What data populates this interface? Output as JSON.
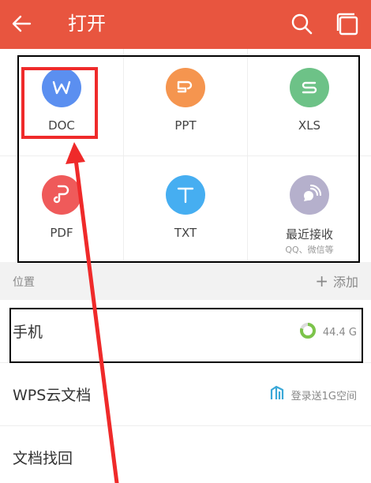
{
  "header": {
    "title": "打开",
    "back_icon": "back-arrow-icon",
    "search_icon": "search-icon",
    "windows_icon": "windows-icon",
    "background": "#e8553f"
  },
  "file_types": [
    {
      "label": "DOC",
      "glyph": "W",
      "color": "#5b8ff0",
      "icon": "doc-icon"
    },
    {
      "label": "PPT",
      "glyph": "P",
      "color": "#f5954f",
      "icon": "ppt-icon"
    },
    {
      "label": "XLS",
      "glyph": "S",
      "color": "#6dc287",
      "icon": "xls-icon"
    },
    {
      "label": "PDF",
      "glyph": "P",
      "color": "#ef5a5a",
      "icon": "pdf-icon"
    },
    {
      "label": "TXT",
      "glyph": "T",
      "color": "#46aef1",
      "icon": "txt-icon"
    },
    {
      "label": "最近接收",
      "sub": "QQ、微信等",
      "color": "#b5b0cc",
      "icon": "recent-received-icon"
    }
  ],
  "location_section": {
    "label": "位置",
    "add_label": "添加"
  },
  "locations": [
    {
      "name": "手机",
      "detail": "44.4 G",
      "icon": "storage-ring-icon",
      "used_fraction": 0.8,
      "ring_color": "#7cc44a"
    },
    {
      "name": "WPS云文档",
      "detail": "登录送1G空间",
      "icon": "cloud-doc-icon",
      "icon_color": "#3aa8d8"
    },
    {
      "name": "文档找回"
    }
  ]
}
